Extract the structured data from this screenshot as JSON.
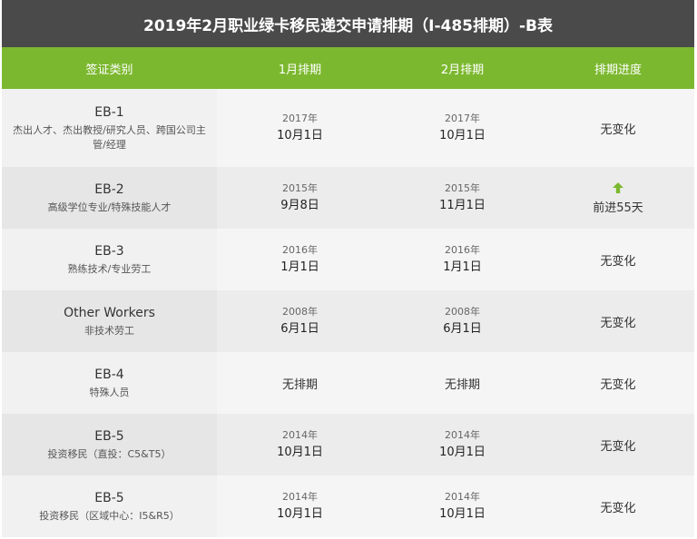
{
  "title": "2019年2月职业绿卡移民递交申请排期（I-485排期）-B表",
  "headers": [
    "签证类别",
    "1月排期",
    "2月排期",
    "排期进度"
  ],
  "colors": {
    "title_bg": "#4a4a4a",
    "header_bg": "#7cb82f",
    "arrow": "#7cb82f"
  },
  "rows": [
    {
      "code": "EB-1",
      "desc": "杰出人才、杰出教授/研究人员、跨国公司主管/经理",
      "jan": {
        "year": "2017年",
        "md": "10月1日"
      },
      "feb": {
        "year": "2017年",
        "md": "10月1日"
      },
      "progress": "无变化",
      "icon": ""
    },
    {
      "code": "EB-2",
      "desc": "高级学位专业/特殊技能人才",
      "jan": {
        "year": "2015年",
        "md": "9月8日"
      },
      "feb": {
        "year": "2015年",
        "md": "11月1日"
      },
      "progress": "前进55天",
      "icon": "arrow-up-icon"
    },
    {
      "code": "EB-3",
      "desc": "熟练技术/专业劳工",
      "jan": {
        "year": "2016年",
        "md": "1月1日"
      },
      "feb": {
        "year": "2016年",
        "md": "1月1日"
      },
      "progress": "无变化",
      "icon": ""
    },
    {
      "code": "Other Workers",
      "desc": "非技术劳工",
      "jan": {
        "year": "2008年",
        "md": "6月1日"
      },
      "feb": {
        "year": "2008年",
        "md": "6月1日"
      },
      "progress": "无变化",
      "icon": ""
    },
    {
      "code": "EB-4",
      "desc": "特殊人员",
      "jan": {
        "year": "",
        "md": "无排期"
      },
      "feb": {
        "year": "",
        "md": "无排期"
      },
      "progress": "无变化",
      "icon": ""
    },
    {
      "code": "EB-5",
      "desc": "投资移民（直投：C5&T5）",
      "jan": {
        "year": "2014年",
        "md": "10月1日"
      },
      "feb": {
        "year": "2014年",
        "md": "10月1日"
      },
      "progress": "无变化",
      "icon": ""
    },
    {
      "code": "EB-5",
      "desc": "投资移民（区域中心：I5&R5）",
      "jan": {
        "year": "2014年",
        "md": "10月1日"
      },
      "feb": {
        "year": "2014年",
        "md": "10月1日"
      },
      "progress": "无变化",
      "icon": ""
    }
  ]
}
